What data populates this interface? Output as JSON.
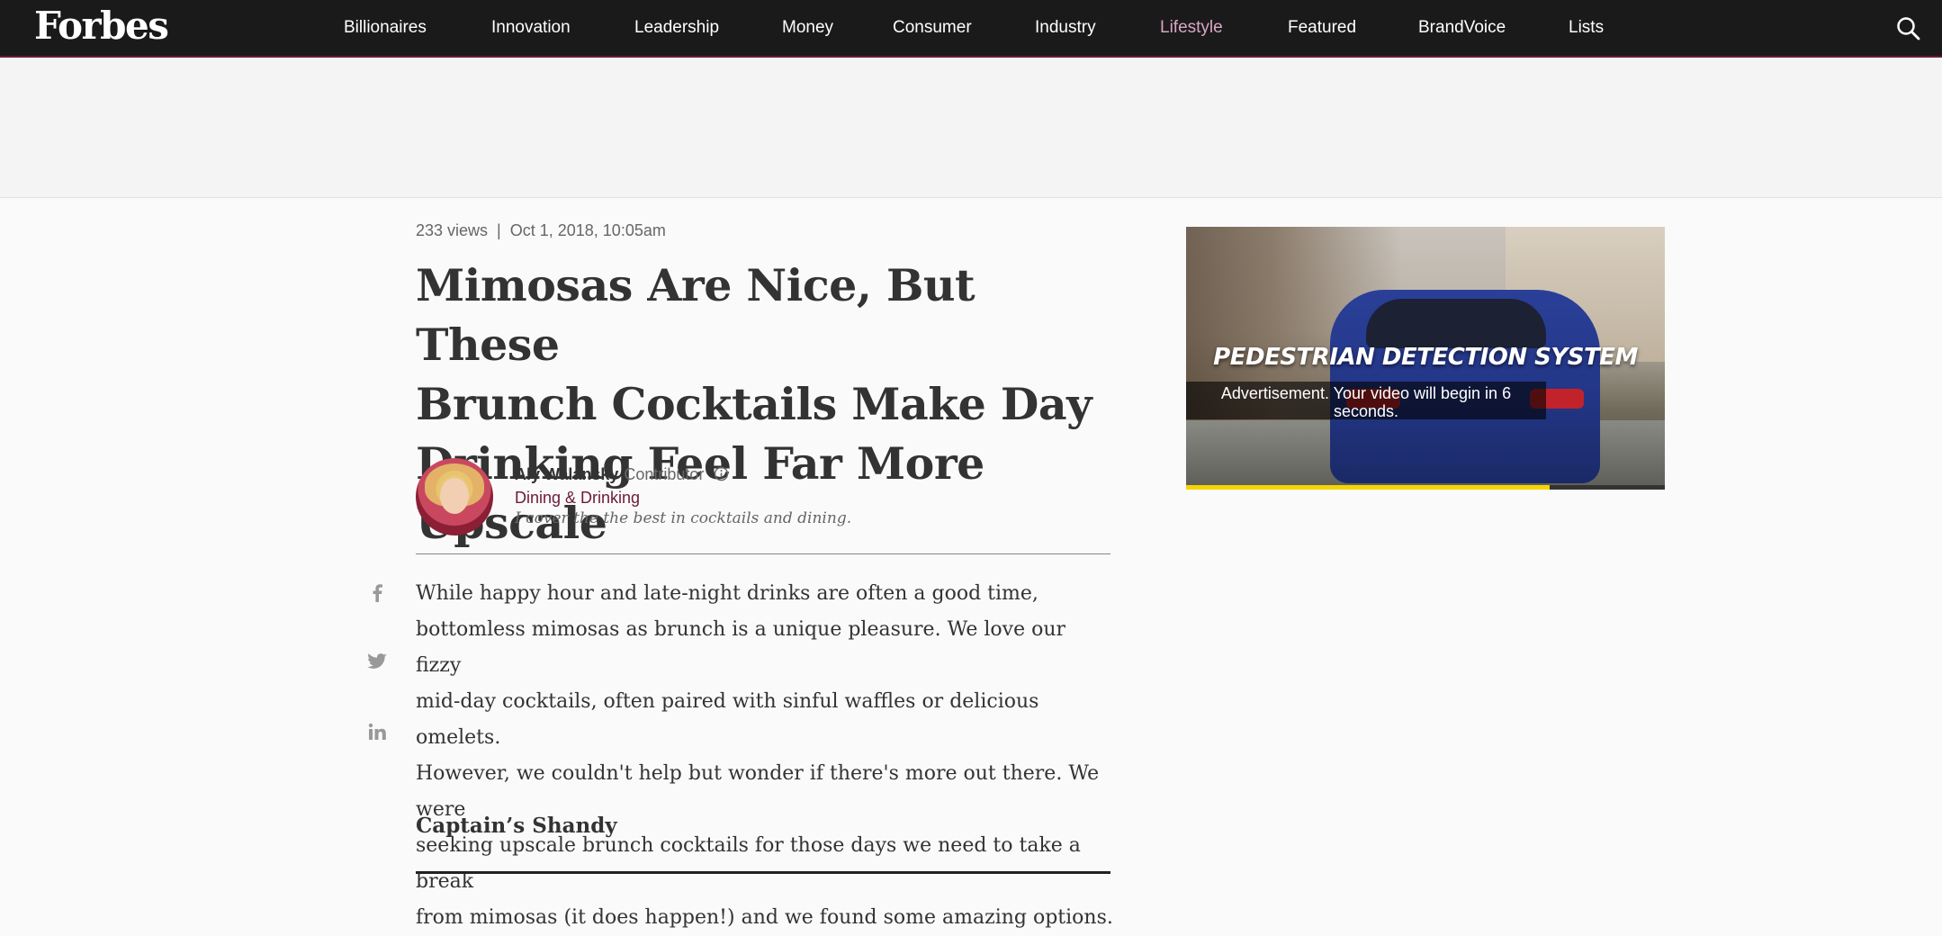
{
  "header": {
    "logo": "Forbes",
    "nav": [
      {
        "label": "Billionaires",
        "active": false
      },
      {
        "label": "Innovation",
        "active": false
      },
      {
        "label": "Leadership",
        "active": false
      },
      {
        "label": "Money",
        "active": false
      },
      {
        "label": "Consumer",
        "active": false
      },
      {
        "label": "Industry",
        "active": false
      },
      {
        "label": "Lifestyle",
        "active": true
      },
      {
        "label": "Featured",
        "active": false
      },
      {
        "label": "BrandVoice",
        "active": false
      },
      {
        "label": "Lists",
        "active": false
      }
    ],
    "search_icon": "search-icon"
  },
  "article": {
    "views": "233 views",
    "separator": "|",
    "date": "Oct 1, 2018, 10:05am",
    "headline_lines": [
      "Mimosas Are Nice, But These",
      "Brunch Cocktails Make Day",
      "Drinking Feel Far More Upscale"
    ],
    "author": {
      "name": "Aly Walansky",
      "role": "Contributor",
      "channel": "Dining & Drinking",
      "bio": "I cover the the best in cocktails and dining."
    },
    "share_icons": [
      "facebook-icon",
      "twitter-icon",
      "linkedin-icon"
    ],
    "body_lines": [
      "While happy hour and late-night drinks are often a good time,",
      "bottomless mimosas as brunch is a unique pleasure. We love our fizzy",
      "mid-day cocktails, often paired with sinful waffles or delicious omelets.",
      "However, we couldn't help but wonder if there's more out there. We were",
      "seeking upscale brunch cocktails for those days we need to take a break",
      "from mimosas (it does happen!) and we found some amazing options."
    ],
    "subhead": "Captain’s Shandy"
  },
  "video_ad": {
    "title": "PEDESTRIAN DETECTION SYSTEM",
    "notice_line1": "Advertisement. Your video will begin in 6",
    "notice_line2": "seconds.",
    "progress": 0.76
  },
  "colors": {
    "nav_bg": "#1a1a1a",
    "accent": "#6d1a3a",
    "active_nav": "#d9a6c4",
    "progress": "#f5d400"
  }
}
